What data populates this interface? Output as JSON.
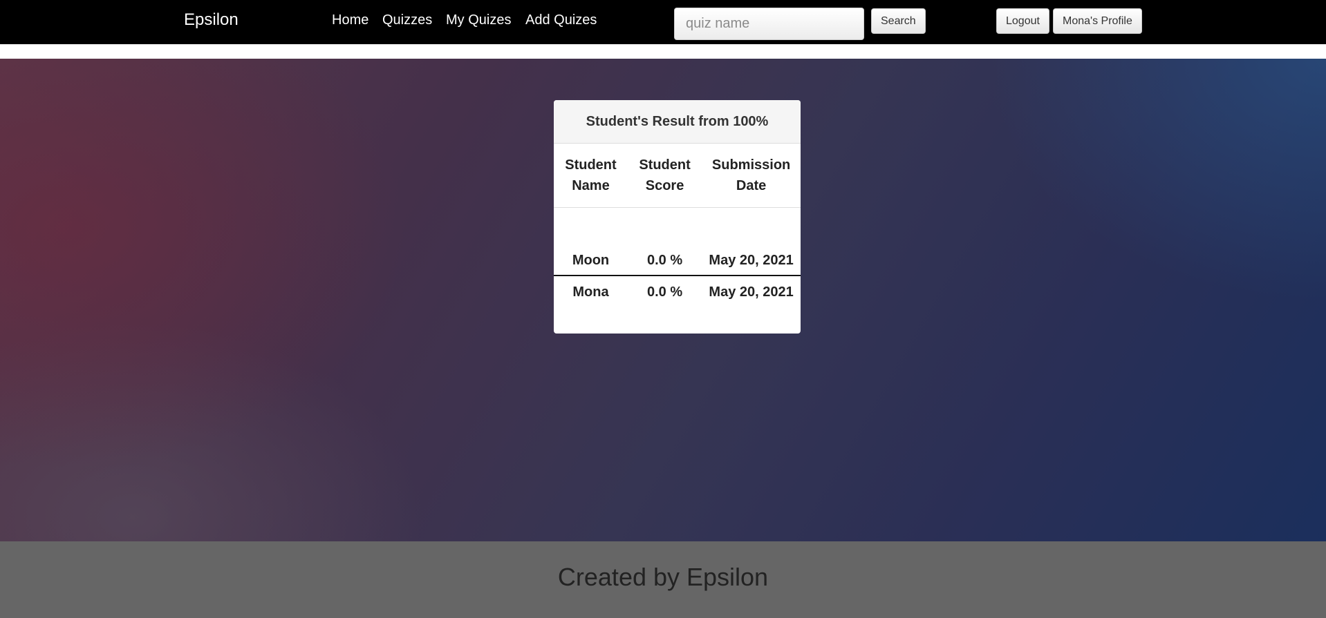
{
  "header": {
    "brand": "Epsilon",
    "nav": {
      "home": "Home",
      "quizzes": "Quizzes",
      "my_quizes": "My Quizes",
      "add_quizes": "Add Quizes"
    },
    "search": {
      "placeholder": "quiz name",
      "value": "",
      "button_label": "Search"
    },
    "logout_label": "Logout",
    "profile_label": "Mona's Profile"
  },
  "results": {
    "title": "Student's Result from 100%",
    "columns": {
      "name": "Student Name",
      "score": "Student Score",
      "date": "Submission Date"
    },
    "rows": [
      {
        "name": "Moon",
        "score": "0.0 %",
        "date": "May 20, 2021"
      },
      {
        "name": "Mona",
        "score": "0.0 %",
        "date": "May 20, 2021"
      }
    ]
  },
  "footer": {
    "text": "Created by Epsilon"
  },
  "colors": {
    "topbar": "#000000",
    "footer": "#666666",
    "card_bg": "#ffffff",
    "gradient_left": "#5a3548",
    "gradient_right": "#1b2f5c"
  }
}
